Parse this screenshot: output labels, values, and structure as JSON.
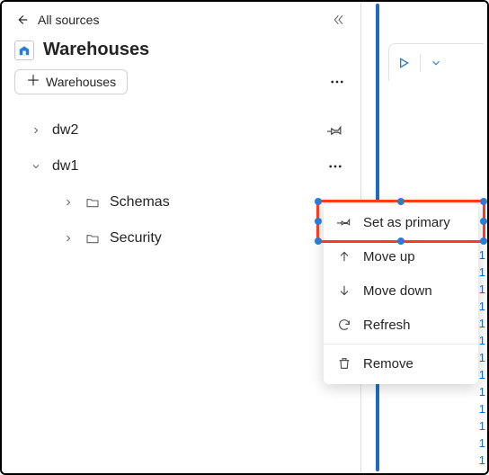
{
  "header": {
    "back_label": "All sources"
  },
  "title": "Warehouses",
  "filter_chip": "Warehouses",
  "tree": {
    "items": [
      {
        "label": "dw2",
        "expanded": false
      },
      {
        "label": "dw1",
        "expanded": true,
        "children": [
          {
            "label": "Schemas"
          },
          {
            "label": "Security"
          }
        ]
      }
    ]
  },
  "context_menu": {
    "set_primary": "Set as primary",
    "move_up": "Move up",
    "move_down": "Move down",
    "refresh": "Refresh",
    "remove": "Remove"
  },
  "line_numbers": [
    "1",
    "1",
    "1",
    "1",
    "1",
    "1",
    "1",
    "1",
    "1",
    "1",
    "1",
    "1",
    "1"
  ],
  "colors": {
    "accent": "#1f6cbf",
    "highlight": "#ff3b1f"
  }
}
